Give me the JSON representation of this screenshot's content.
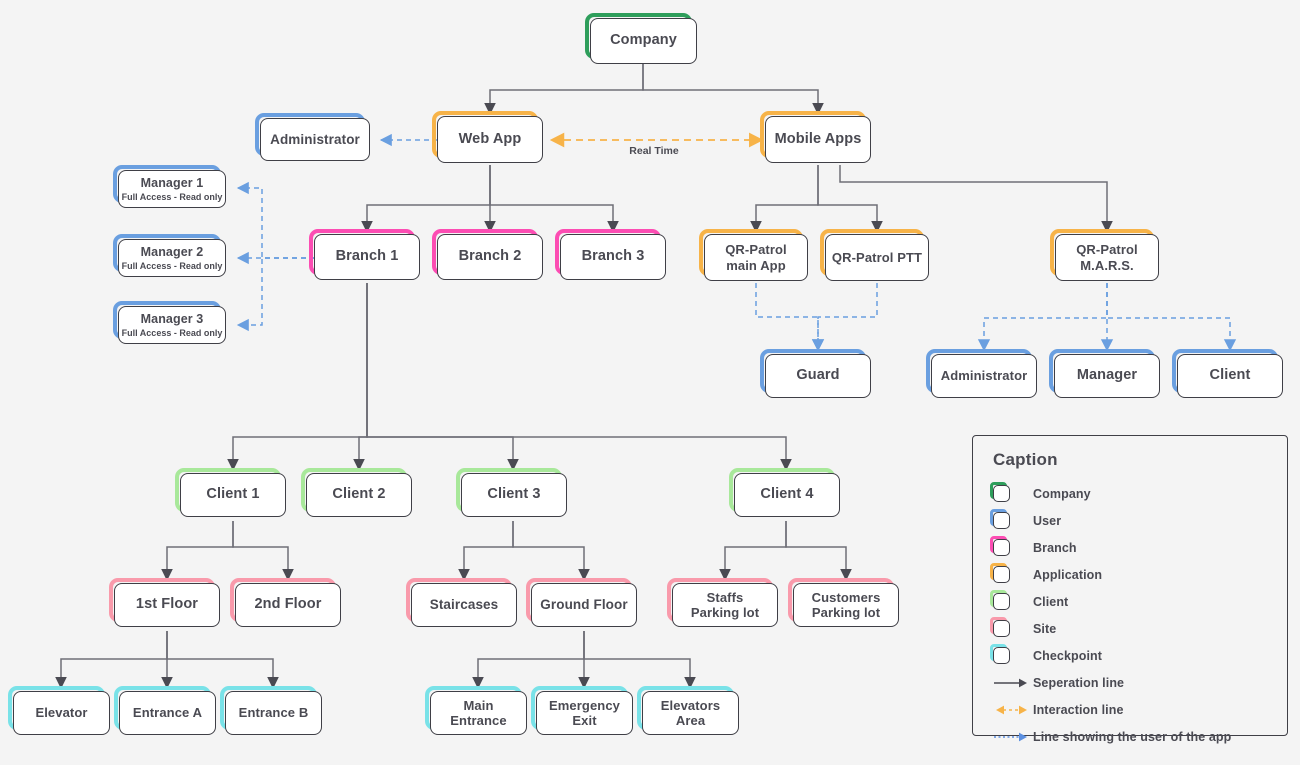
{
  "diagram": {
    "background": "#f4f4f4",
    "edge_label_real_time": "Real Time"
  },
  "colors": {
    "company": "#2e9e5b",
    "user": "#6a9fe0",
    "branch": "#fc4db3",
    "application": "#f7b348",
    "client": "#a8e89a",
    "site": "#f99aab",
    "checkpoint": "#79e2e8",
    "separation_line": "#4a4a52",
    "interaction_line": "#f7b348",
    "user_of_app_line": "#5b8fe0",
    "box_outline": "#3f3f46",
    "text": "#4a4a52"
  },
  "nodes": {
    "company": {
      "label": "Company",
      "type": "company"
    },
    "web_app": {
      "label": "Web App",
      "type": "application"
    },
    "mobile_apps": {
      "label": "Mobile Apps",
      "type": "application"
    },
    "administrator_web": {
      "label": "Administrator",
      "type": "user"
    },
    "manager1": {
      "label": "Manager 1",
      "sub": "Full Access - Read only",
      "type": "user"
    },
    "manager2": {
      "label": "Manager 2",
      "sub": "Full Access - Read only",
      "type": "user"
    },
    "manager3": {
      "label": "Manager 3",
      "sub": "Full Access - Read only",
      "type": "user"
    },
    "branch1": {
      "label": "Branch 1",
      "type": "branch"
    },
    "branch2": {
      "label": "Branch 2",
      "type": "branch"
    },
    "branch3": {
      "label": "Branch 3",
      "type": "branch"
    },
    "qr_main": {
      "label": "QR-Patrol\nmain App",
      "type": "application"
    },
    "qr_ptt": {
      "label": "QR-Patrol PTT",
      "type": "application"
    },
    "qr_mars": {
      "label": "QR-Patrol\nM.A.R.S.",
      "type": "application"
    },
    "guard": {
      "label": "Guard",
      "type": "user"
    },
    "administrator_m": {
      "label": "Administrator",
      "type": "user"
    },
    "manager_m": {
      "label": "Manager",
      "type": "user"
    },
    "client_m": {
      "label": "Client",
      "type": "user"
    },
    "client1": {
      "label": "Client 1",
      "type": "client"
    },
    "client2": {
      "label": "Client 2",
      "type": "client"
    },
    "client3": {
      "label": "Client 3",
      "type": "client"
    },
    "client4": {
      "label": "Client 4",
      "type": "client"
    },
    "floor1": {
      "label": "1st Floor",
      "type": "site"
    },
    "floor2": {
      "label": "2nd Floor",
      "type": "site"
    },
    "staircases": {
      "label": "Staircases",
      "type": "site"
    },
    "ground_floor": {
      "label": "Ground Floor",
      "type": "site"
    },
    "staffs_parking": {
      "label": "Staffs\nParking lot",
      "type": "site"
    },
    "customers_parking": {
      "label": "Customers\nParking lot",
      "type": "site"
    },
    "elevator": {
      "label": "Elevator",
      "type": "checkpoint"
    },
    "entrance_a": {
      "label": "Entrance A",
      "type": "checkpoint"
    },
    "entrance_b": {
      "label": "Entrance B",
      "type": "checkpoint"
    },
    "main_entrance": {
      "label": "Main\nEntrance",
      "type": "checkpoint"
    },
    "emergency_exit": {
      "label": "Emergency\nExit",
      "type": "checkpoint"
    },
    "elevators_area": {
      "label": "Elevators\nArea",
      "type": "checkpoint"
    }
  },
  "caption": {
    "title": "Caption",
    "items": [
      {
        "label": "Company",
        "kind": "box",
        "color": "#2e9e5b"
      },
      {
        "label": "User",
        "kind": "box",
        "color": "#6a9fe0"
      },
      {
        "label": "Branch",
        "kind": "box",
        "color": "#fc4db3"
      },
      {
        "label": "Application",
        "kind": "box",
        "color": "#f7b348"
      },
      {
        "label": "Client",
        "kind": "box",
        "color": "#a8e89a"
      },
      {
        "label": "Site",
        "kind": "box",
        "color": "#f99aab"
      },
      {
        "label": "Checkpoint",
        "kind": "box",
        "color": "#79e2e8"
      },
      {
        "label": "Seperation line",
        "kind": "line-solid",
        "color": "#4a4a52"
      },
      {
        "label": "Interaction line",
        "kind": "line-bidir",
        "color": "#f7b348"
      },
      {
        "label": "Line showing the user of the app",
        "kind": "line-dotted",
        "color": "#5b8fe0"
      }
    ]
  }
}
